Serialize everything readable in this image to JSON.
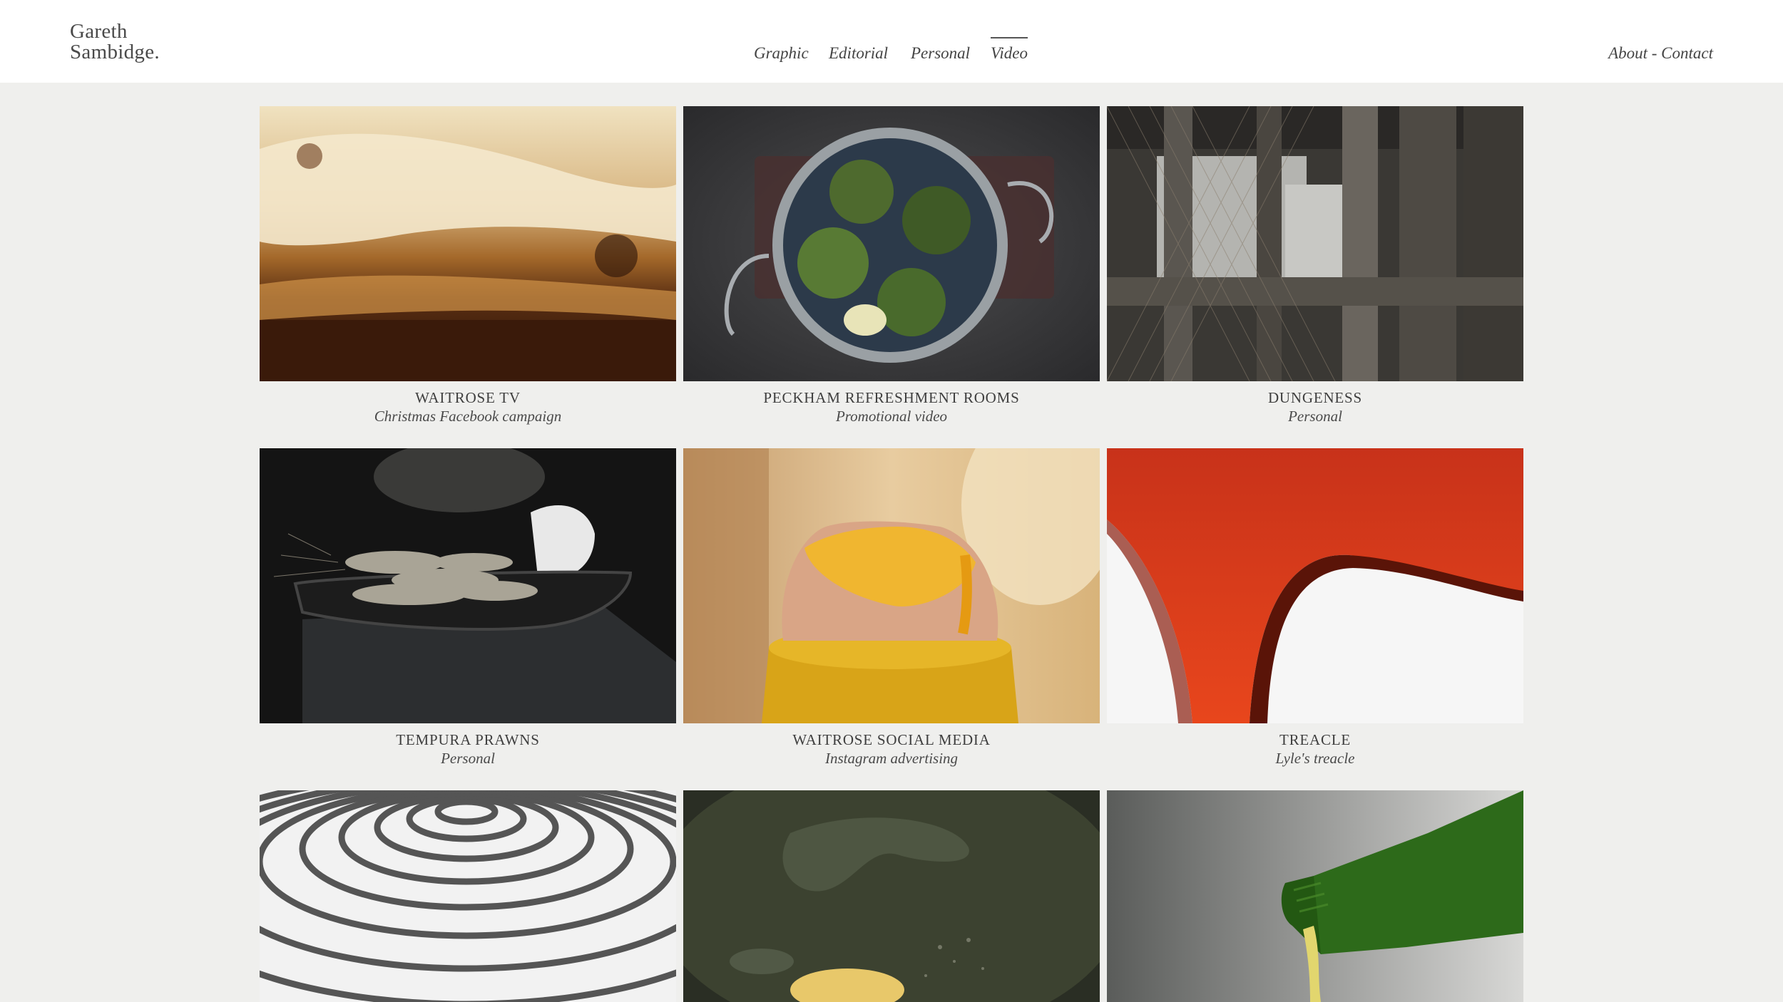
{
  "logo": {
    "line1": "Gareth",
    "line2": "Sambidge."
  },
  "nav": {
    "items": [
      {
        "label": "Graphic"
      },
      {
        "label": "Editorial"
      },
      {
        "label": "Personal"
      },
      {
        "label": "Video"
      }
    ],
    "active": "Video",
    "about_contact": "About - Contact"
  },
  "projects": [
    {
      "title": "WAITROSE TV",
      "subtitle": "Christmas Facebook campaign"
    },
    {
      "title": "PECKHAM REFRESHMENT ROOMS",
      "subtitle": "Promotional video"
    },
    {
      "title": "DUNGENESS",
      "subtitle": "Personal"
    },
    {
      "title": "TEMPURA PRAWNS",
      "subtitle": "Personal"
    },
    {
      "title": "WAITROSE SOCIAL MEDIA",
      "subtitle": "Instagram advertising"
    },
    {
      "title": "TREACLE",
      "subtitle": "Lyle's treacle"
    }
  ],
  "colors": {
    "background": "#efefed",
    "header": "#ffffff",
    "text": "#3d3d3d"
  }
}
